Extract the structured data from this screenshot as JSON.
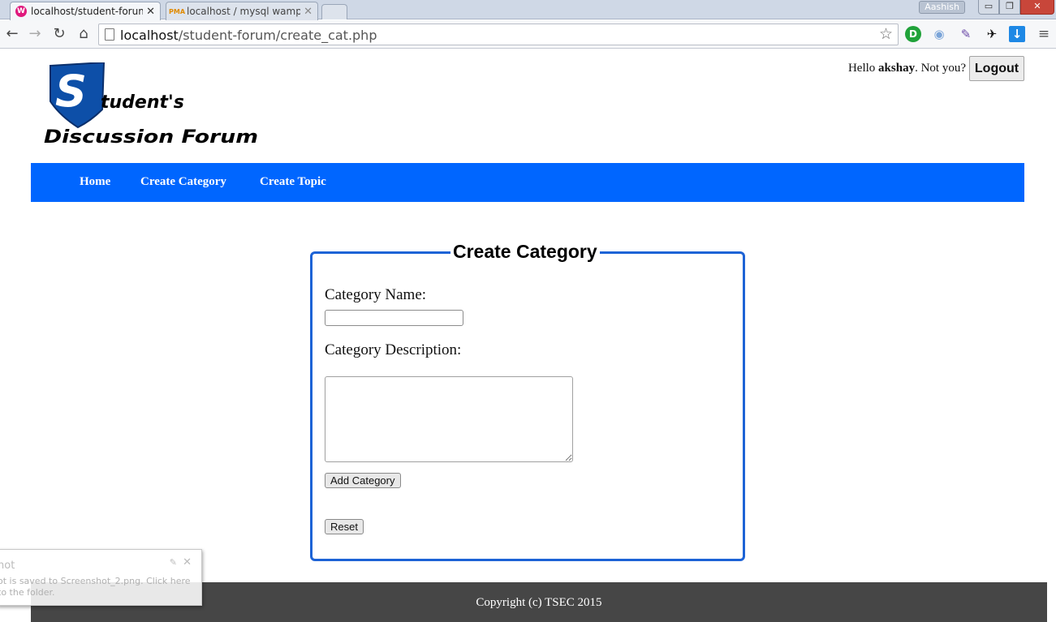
{
  "browser": {
    "tabs": [
      {
        "title": "localhost/student-forum/c",
        "favicon": "wamp-icon"
      },
      {
        "title": "localhost / mysql wampse",
        "favicon": "pma-icon",
        "favicon_text": "PMA"
      }
    ],
    "user_badge": "Aashish",
    "window_buttons": {
      "minimize": "▭",
      "maximize": "❐",
      "close": "✕"
    },
    "url_host": "localhost",
    "url_path": "/student-forum/create_cat.php"
  },
  "header": {
    "greeting_prefix": "Hello ",
    "username": "akshay",
    "greeting_suffix": ". Not you?",
    "logout_label": "Logout",
    "logo_line1": "tudent's",
    "logo_letter": "S",
    "logo_line2": "Discussion Forum"
  },
  "nav": {
    "items": [
      "Home",
      "Create Category",
      "Create Topic"
    ],
    "color": "#0066ff"
  },
  "form": {
    "title": "Create Category",
    "name_label": "Category Name:",
    "name_value": "",
    "description_label": "Category Description:",
    "description_value": "",
    "submit_label": "Add Category",
    "reset_label": "Reset",
    "border_color": "#1d63d6"
  },
  "footer": {
    "text": "Copyright (c) TSEC 2015",
    "color": "#464646"
  },
  "toast": {
    "title": "hot",
    "message": "ot is saved to Screenshot_2.png. Click here to the folder."
  }
}
